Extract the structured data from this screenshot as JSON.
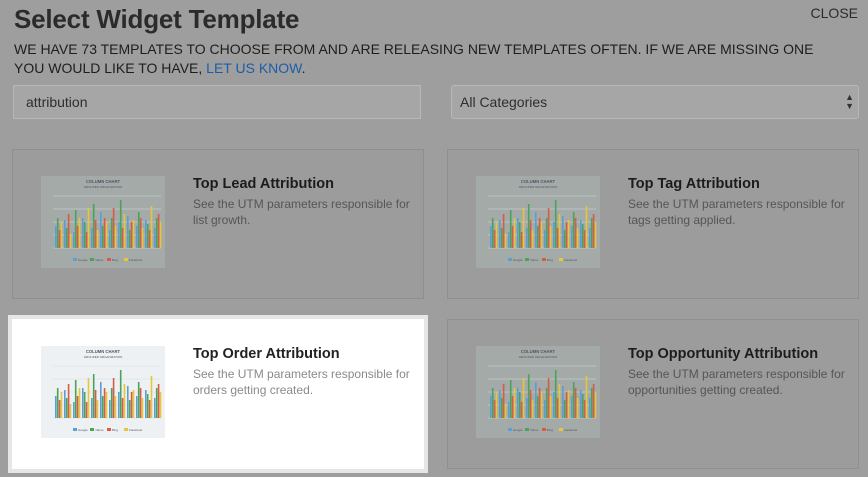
{
  "header": {
    "title": "Select Widget Template",
    "close_label": "CLOSE",
    "intro_text": "We have 73 templates to choose from and are releasing new templates often. If we are missing one you would like to have,",
    "intro_link": "let us know",
    "intro_end": "."
  },
  "filters": {
    "search_value": "attribution",
    "category_value": "All Categories"
  },
  "thumbnail": {
    "chart_title": "COLUMN CHART",
    "chart_subtitle": "GROUPED ORGANIZATION",
    "legend": [
      "Google",
      "Yahoo",
      "Bing",
      "Facebook"
    ],
    "colors": [
      "#5a9fd4",
      "#4aa35a",
      "#d95b43",
      "#e7c63c"
    ]
  },
  "templates": [
    {
      "title": "Top Lead Attribution",
      "description": "See the UTM parameters responsible for list growth.",
      "selected": false
    },
    {
      "title": "Top Tag Attribution",
      "description": "See the UTM parameters responsible for tags getting applied.",
      "selected": false
    },
    {
      "title": "Top Order Attribution",
      "description": "See the UTM parameters responsible for orders getting created.",
      "selected": true
    },
    {
      "title": "Top Opportunity Attribution",
      "description": "See the UTM parameters responsible for opportunities getting created.",
      "selected": false
    }
  ]
}
